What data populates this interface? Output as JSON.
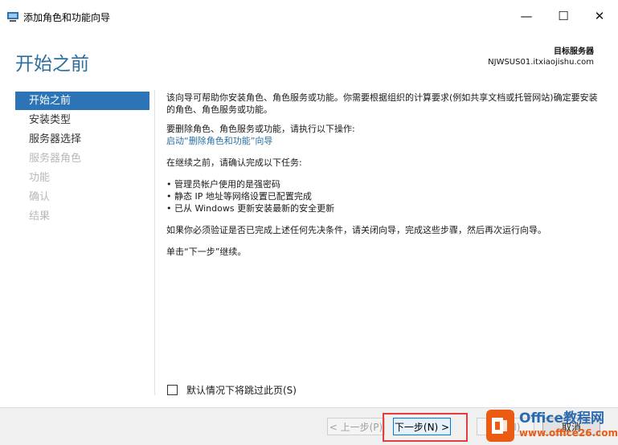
{
  "window": {
    "title": "添加角色和功能向导",
    "minimize_glyph": "—",
    "maximize_glyph": "☐",
    "close_glyph": "✕"
  },
  "header": {
    "title": "开始之前",
    "target_label": "目标服务器",
    "target_server": "NJWSUS01.itxiaojishu.com"
  },
  "sidebar": {
    "items": [
      {
        "label": "开始之前",
        "state": "active"
      },
      {
        "label": "安装类型",
        "state": "normal"
      },
      {
        "label": "服务器选择",
        "state": "normal"
      },
      {
        "label": "服务器角色",
        "state": "disabled"
      },
      {
        "label": "功能",
        "state": "disabled"
      },
      {
        "label": "确认",
        "state": "disabled"
      },
      {
        "label": "结果",
        "state": "disabled"
      }
    ]
  },
  "content": {
    "intro": "该向导可帮助你安装角色、角色服务或功能。你需要根据组织的计算要求(例如共享文档或托管网站)确定要安装的角色、角色服务或功能。",
    "remove_text": "要删除角色、角色服务或功能，请执行以下操作:",
    "remove_link": "启动“删除角色和功能”向导",
    "before_text": "在继续之前，请确认完成以下任务:",
    "tasks": [
      "管理员帐户使用的是强密码",
      "静态 IP 地址等网络设置已配置完成",
      "已从 Windows 更新安装最新的安全更新"
    ],
    "verify_text": "如果你必须验证是否已完成上述任何先决条件，请关闭向导，完成这些步骤，然后再次运行向导。",
    "click_next": "单击“下一步”继续。"
  },
  "skip_checkbox": {
    "label": "默认情况下将跳过此页(S)",
    "checked": false
  },
  "buttons": {
    "prev": "< 上一步(P)",
    "next": "下一步(N) >",
    "install": "安装(I)",
    "cancel": "取消"
  },
  "watermark": {
    "line1": "Office教程网",
    "line2": "www.office26.com"
  },
  "colors": {
    "accent": "#2d74b7",
    "header_text": "#2b6fa0",
    "highlight_box": "#e53d3d",
    "watermark_orange": "#ec5b12"
  }
}
